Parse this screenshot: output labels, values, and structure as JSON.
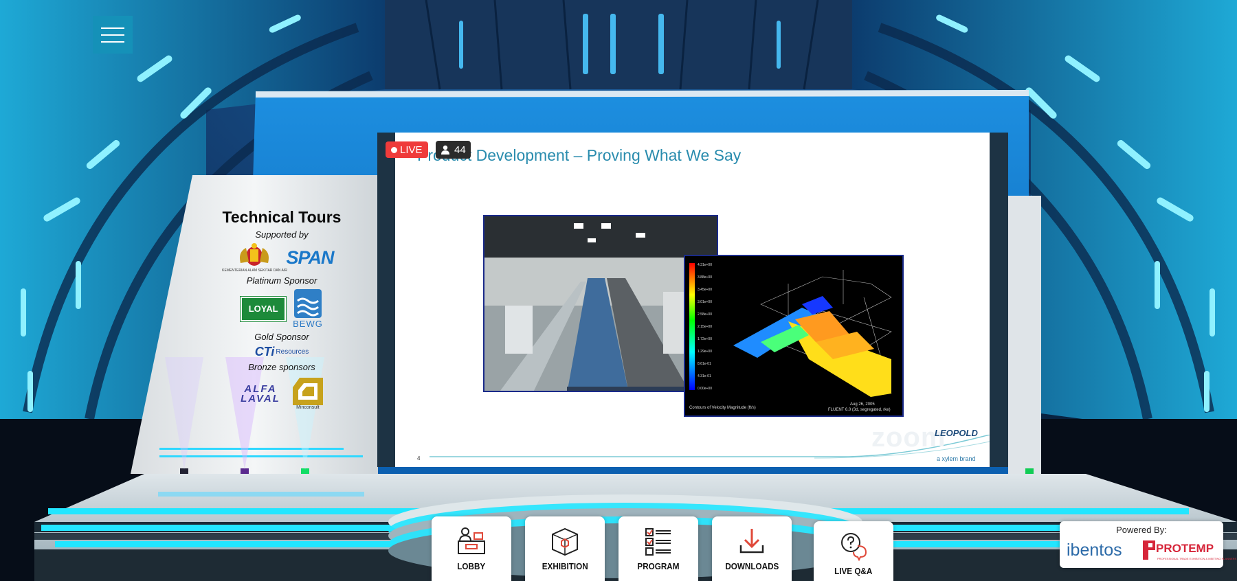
{
  "menu": {
    "label": "Menu"
  },
  "sponsors": {
    "title": "Technical Tours",
    "supported_by": "Supported by",
    "kementerian": "KEMENTERIAN ALAM SEKITAR DAN AIR",
    "span": "SPAN",
    "platinum": "Platinum Sponsor",
    "loyal": "LOYAL",
    "bewg": "BEWG",
    "gold": "Gold Sponsor",
    "cti": "CTi",
    "cti_resources": "Resources",
    "bronze": "Bronze sponsors",
    "alfa_line1": "ALFA",
    "alfa_line2": "LAVAL",
    "minconsult": "Minconsult"
  },
  "stream": {
    "live_label": "LIVE",
    "viewer_count": "44",
    "slide_title": "Product Development – Proving What We Say",
    "slide_number": "4",
    "watermark": "zoom",
    "brand": "LEOPOLD",
    "brand_sub": "a xylem brand",
    "cfd_caption": "Contours of Velocity Magnitude (ft/s)",
    "cfd_date": "Aug 26, 2005",
    "cfd_solver": "FLUENT 6.0 (3d, segregated, rke)",
    "cfd_scale": [
      "4.31e+00",
      "3.88e+00",
      "3.45e+00",
      "3.01e+00",
      "2.58e+00",
      "2.15e+00",
      "1.72e+00",
      "1.29e+00",
      "8.61e-01",
      "4.31e-01",
      "0.00e+00"
    ]
  },
  "nav": [
    {
      "label": "LOBBY",
      "icon": "reception-desk-icon"
    },
    {
      "label": "EXHIBITION",
      "icon": "exhibition-booth-icon"
    },
    {
      "label": "PROGRAM",
      "icon": "checklist-icon"
    },
    {
      "label": "DOWNLOADS",
      "icon": "download-icon"
    },
    {
      "label": "LIVE Q&A",
      "icon": "chat-question-icon"
    }
  ],
  "powered": {
    "label": "Powered By:",
    "ibentos": "ibentos",
    "protemp": "PROTEMP",
    "protemp_sub": "PROFESSIONAL TRADE EXHIBITION & MEETING PLANNERS"
  },
  "colors": {
    "accent": "#1591b8",
    "live": "#ef3b3b",
    "title": "#2a8cae",
    "neon": "#22e6ff"
  }
}
